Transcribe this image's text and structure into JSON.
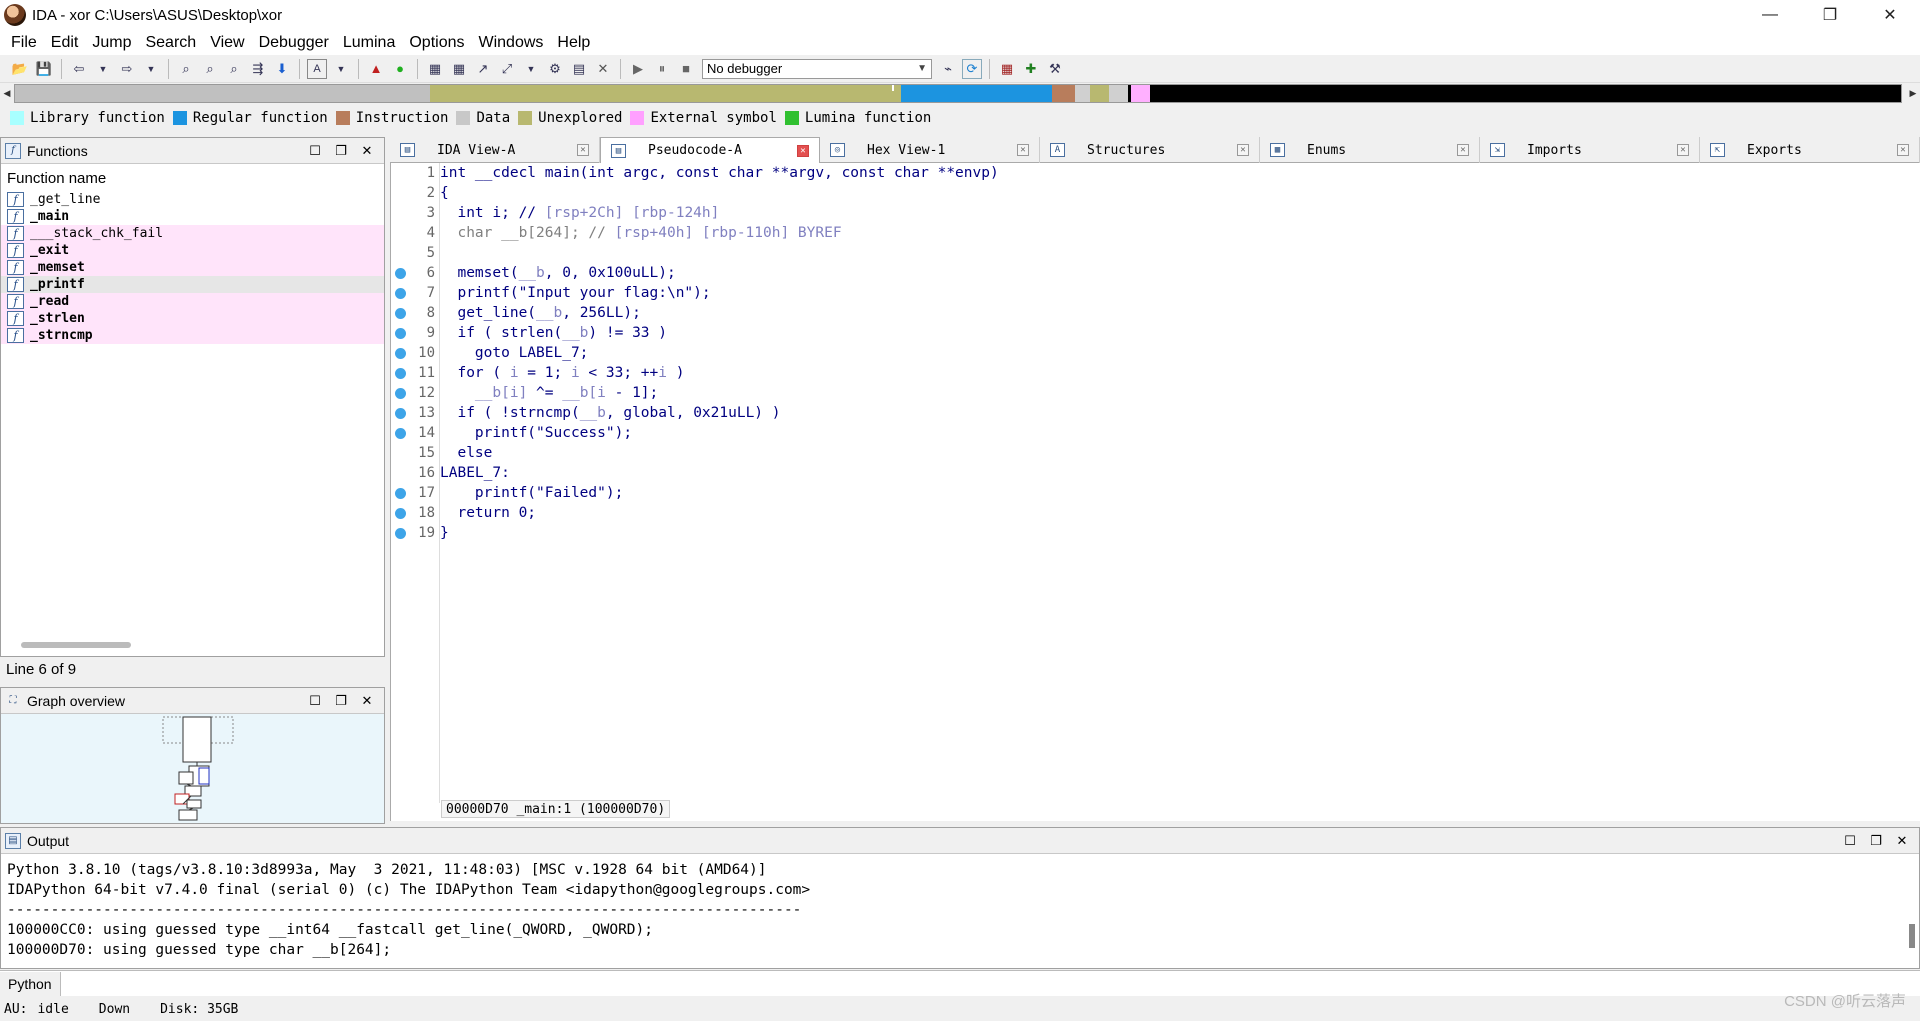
{
  "window": {
    "title": "IDA - xor C:\\Users\\ASUS\\Desktop\\xor",
    "controls": {
      "minimize": "—",
      "restore": "❐",
      "close": "✕"
    }
  },
  "menu": [
    "File",
    "Edit",
    "Jump",
    "Search",
    "View",
    "Debugger",
    "Lumina",
    "Options",
    "Windows",
    "Help"
  ],
  "toolbar": {
    "debugger_select": "No debugger"
  },
  "navband": {
    "segments": [
      {
        "color": "#c0c0c0",
        "width": 22
      },
      {
        "color": "#b8b870",
        "width": 25
      },
      {
        "color": "#1c94e0",
        "width": 8
      },
      {
        "color": "#b87d5c",
        "width": 1.2
      },
      {
        "color": "#d0d0d0",
        "width": 0.8
      },
      {
        "color": "#b8b870",
        "width": 1
      },
      {
        "color": "#d0d0d0",
        "width": 1
      },
      {
        "color": "#000000",
        "width": 0.2
      },
      {
        "color": "#ffb0ff",
        "width": 1
      },
      {
        "color": "#000000",
        "width": 39.8
      }
    ]
  },
  "legend": [
    {
      "label": "Library function",
      "color": "#a8ffff"
    },
    {
      "label": "Regular function",
      "color": "#1c94e0"
    },
    {
      "label": "Instruction",
      "color": "#b87d5c"
    },
    {
      "label": "Data",
      "color": "#c8c8c8"
    },
    {
      "label": "Unexplored",
      "color": "#b8b870"
    },
    {
      "label": "External symbol",
      "color": "#ffa0ff"
    },
    {
      "label": "Lumina function",
      "color": "#30c030"
    }
  ],
  "functions_panel": {
    "title": "Functions",
    "header": "Function name",
    "items": [
      {
        "name": "_get_line",
        "bold": false,
        "pink": false,
        "sel": false
      },
      {
        "name": "_main",
        "bold": true,
        "pink": false,
        "sel": false
      },
      {
        "name": "___stack_chk_fail",
        "bold": false,
        "pink": true,
        "sel": false
      },
      {
        "name": "_exit",
        "bold": true,
        "pink": true,
        "sel": false
      },
      {
        "name": "_memset",
        "bold": true,
        "pink": true,
        "sel": false
      },
      {
        "name": "_printf",
        "bold": true,
        "pink": false,
        "sel": true
      },
      {
        "name": "_read",
        "bold": true,
        "pink": true,
        "sel": false
      },
      {
        "name": "_strlen",
        "bold": true,
        "pink": true,
        "sel": false
      },
      {
        "name": "_strncmp",
        "bold": true,
        "pink": true,
        "sel": false
      }
    ],
    "line_status": "Line 6 of 9"
  },
  "graph_panel": {
    "title": "Graph overview"
  },
  "tabs": [
    {
      "label": "IDA View-A",
      "active": false,
      "icon": "▤"
    },
    {
      "label": "Pseudocode-A",
      "active": true,
      "icon": "▤"
    },
    {
      "label": "Hex View-1",
      "active": false,
      "icon": "◎"
    },
    {
      "label": "Structures",
      "active": false,
      "icon": "A"
    },
    {
      "label": "Enums",
      "active": false,
      "icon": "▦"
    },
    {
      "label": "Imports",
      "active": false,
      "icon": "⇲"
    },
    {
      "label": "Exports",
      "active": false,
      "icon": "⇱"
    }
  ],
  "code": [
    {
      "n": "1",
      "bp": false,
      "parts": [
        [
          "int __cdecl main(int argc, const char **argv, const char **envp)",
          "k-normal"
        ]
      ]
    },
    {
      "n": "2",
      "bp": false,
      "parts": [
        [
          "{",
          "k-normal"
        ]
      ]
    },
    {
      "n": "3",
      "bp": false,
      "parts": [
        [
          "  int i; // ",
          "k-normal"
        ],
        [
          "[rsp+2Ch] [rbp-124h]",
          "k-comment"
        ]
      ]
    },
    {
      "n": "4",
      "bp": false,
      "parts": [
        [
          "  char __b[264]; // ",
          "k-gray"
        ],
        [
          "[rsp+40h] [rbp-110h] BYREF",
          "k-comment"
        ]
      ]
    },
    {
      "n": "5",
      "bp": false,
      "parts": [
        [
          "",
          "k-normal"
        ]
      ]
    },
    {
      "n": "6",
      "bp": true,
      "parts": [
        [
          "  memset(",
          "k-normal"
        ],
        [
          "__b",
          "k-comment"
        ],
        [
          ", 0, 0x100uLL);",
          "k-normal"
        ]
      ]
    },
    {
      "n": "7",
      "bp": true,
      "parts": [
        [
          "  printf(\"Input your flag:\\n\");",
          "k-normal"
        ]
      ]
    },
    {
      "n": "8",
      "bp": true,
      "parts": [
        [
          "  get_line(",
          "k-normal"
        ],
        [
          "__b",
          "k-comment"
        ],
        [
          ", 256LL);",
          "k-normal"
        ]
      ]
    },
    {
      "n": "9",
      "bp": true,
      "parts": [
        [
          "  if ( strlen(",
          "k-normal"
        ],
        [
          "__b",
          "k-comment"
        ],
        [
          ") != 33 )",
          "k-normal"
        ]
      ]
    },
    {
      "n": "10",
      "bp": true,
      "parts": [
        [
          "    goto LABEL_7;",
          "k-normal"
        ]
      ]
    },
    {
      "n": "11",
      "bp": true,
      "parts": [
        [
          "  for ( ",
          "k-normal"
        ],
        [
          "i",
          "k-comment"
        ],
        [
          " = 1; ",
          "k-normal"
        ],
        [
          "i",
          "k-comment"
        ],
        [
          " < 33; ++",
          "k-normal"
        ],
        [
          "i",
          "k-comment"
        ],
        [
          " )",
          "k-normal"
        ]
      ]
    },
    {
      "n": "12",
      "bp": true,
      "parts": [
        [
          "    ",
          "k-normal"
        ],
        [
          "__b[i]",
          "k-comment"
        ],
        [
          " ^= ",
          "k-normal"
        ],
        [
          "__b[i",
          "k-comment"
        ],
        [
          " - 1];",
          "k-normal"
        ]
      ]
    },
    {
      "n": "13",
      "bp": true,
      "parts": [
        [
          "  if ( !strncmp(",
          "k-normal"
        ],
        [
          "__b",
          "k-comment"
        ],
        [
          ", global, 0x21uLL) )",
          "k-normal"
        ]
      ]
    },
    {
      "n": "14",
      "bp": true,
      "parts": [
        [
          "    printf(\"Success\");",
          "k-normal"
        ]
      ]
    },
    {
      "n": "15",
      "bp": false,
      "parts": [
        [
          "  else",
          "k-normal"
        ]
      ]
    },
    {
      "n": "16",
      "bp": false,
      "parts": [
        [
          "LABEL_7:",
          "k-normal"
        ]
      ]
    },
    {
      "n": "17",
      "bp": true,
      "parts": [
        [
          "    printf(\"Failed\");",
          "k-normal"
        ]
      ]
    },
    {
      "n": "18",
      "bp": true,
      "parts": [
        [
          "  return 0;",
          "k-normal"
        ]
      ]
    },
    {
      "n": "19",
      "bp": true,
      "parts": [
        [
          "}",
          "k-normal"
        ]
      ]
    }
  ],
  "code_status": "00000D70 _main:1 (100000D70)",
  "output_panel": {
    "title": "Output",
    "lines": [
      "Python 3.8.10 (tags/v3.8.10:3d8993a, May  3 2021, 11:48:03) [MSC v.1928 64 bit (AMD64)]",
      "IDAPython 64-bit v7.4.0 final (serial 0) (c) The IDAPython Team <idapython@googlegroups.com>",
      "-------------------------------------------------------------------------------------------",
      "100000CC0: using guessed type __int64 __fastcall get_line(_QWORD, _QWORD);",
      "100000D70: using guessed type char __b[264];"
    ]
  },
  "python_button": "Python",
  "statusbar": {
    "au": "AU:",
    "state": "idle",
    "direction": "Down",
    "disk": "Disk: 35GB"
  },
  "watermark": "CSDN @听云落声"
}
